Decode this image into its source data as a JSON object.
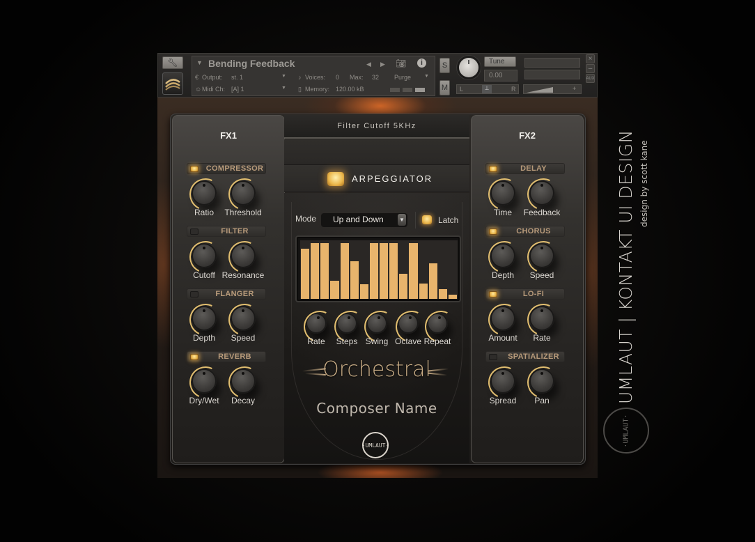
{
  "kontakt_header": {
    "instrument_name": "Bending Feedback",
    "output_label": "Output:",
    "output_value": "st. 1",
    "midi_label": "Midi Ch:",
    "midi_value": "[A]  1",
    "voices_label": "Voices:",
    "voices_value": "0",
    "max_label": "Max:",
    "max_value": "32",
    "memory_label": "Memory:",
    "memory_value": "120.00 kB",
    "purge_label": "Purge",
    "solo_label": "S",
    "mute_label": "M",
    "tune_label": "Tune",
    "tune_value": "0.00",
    "pan_left": "L",
    "pan_right": "R",
    "aux_label": "AUX",
    "close_label": "×",
    "minimize_label": "–",
    "vol_minus": "-",
    "vol_plus": "+",
    "icons": {
      "wrench": "wrench-icon",
      "instrument": "instrument-logo-icon",
      "camera": "camera-icon",
      "info": "info-icon",
      "prev": "prev-arrow-icon",
      "next": "next-arrow-icon"
    }
  },
  "status_bar": {
    "text": "Filter Cutoff 5KHz"
  },
  "fx1": {
    "title": "FX1",
    "sections": [
      {
        "name": "COMPRESSOR",
        "enabled": true,
        "knobs": [
          "Ratio",
          "Threshold"
        ]
      },
      {
        "name": "FILTER",
        "enabled": false,
        "knobs": [
          "Cutoff",
          "Resonance"
        ]
      },
      {
        "name": "FLANGER",
        "enabled": false,
        "knobs": [
          "Depth",
          "Speed"
        ]
      },
      {
        "name": "REVERB",
        "enabled": true,
        "knobs": [
          "Dry/Wet",
          "Decay"
        ]
      }
    ]
  },
  "fx2": {
    "title": "FX2",
    "sections": [
      {
        "name": "DELAY",
        "enabled": true,
        "knobs": [
          "Time",
          "Feedback"
        ]
      },
      {
        "name": "CHORUS",
        "enabled": true,
        "knobs": [
          "Depth",
          "Speed"
        ]
      },
      {
        "name": "LO-FI",
        "enabled": true,
        "knobs": [
          "Amount",
          "Rate"
        ]
      },
      {
        "name": "SPATIALIZER",
        "enabled": false,
        "knobs": [
          "Spread",
          "Pan"
        ]
      }
    ]
  },
  "arpeggiator": {
    "title": "ARPEGGIATOR",
    "enabled": true,
    "mode_label": "Mode",
    "mode_value": "Up and Down",
    "latch_label": "Latch",
    "latch_enabled": true,
    "step_values": [
      0.9,
      1.0,
      1.0,
      0.33,
      1.0,
      0.68,
      0.26,
      1.0,
      1.0,
      1.0,
      0.45,
      1.0,
      0.27,
      0.64,
      0.17,
      0.08
    ],
    "knobs": [
      "Rate",
      "Steps",
      "Swing",
      "Octave",
      "Repeat"
    ]
  },
  "branding": {
    "product": "Orchestral",
    "composer": "Composer Name",
    "logo_text": "·UMLAUT·",
    "side_title": "UMLAUT | KONTAKT UI DESIGN",
    "side_subtitle": "design by scott kane"
  },
  "colors": {
    "accent_amber": "#e8b46c",
    "led_on": "#ebb64a",
    "section_label": "#b79a7a",
    "knob_ring": "#e0bd6f"
  }
}
